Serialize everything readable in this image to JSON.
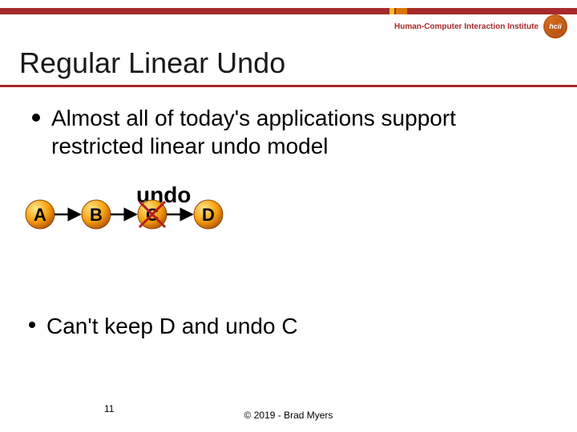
{
  "brand": {
    "text": "Human-Computer Interaction Institute",
    "logo_label": "hcii"
  },
  "title": "Regular Linear Undo",
  "bullets": {
    "b1": "Almost all of today's applications support restricted linear undo model",
    "b2": "Can't keep D and undo C"
  },
  "diagram": {
    "undo_label": "undo",
    "nodes": [
      "A",
      "B",
      "C",
      "D"
    ],
    "crossed_out_index": 2
  },
  "footer": {
    "slide_number": "11",
    "copyright": "© 2019 - Brad Myers"
  },
  "colors": {
    "rule": "#a52a2a",
    "node_fill": "#f59e0b",
    "node_stroke": "#b45309",
    "cross": "#b91c1c"
  }
}
